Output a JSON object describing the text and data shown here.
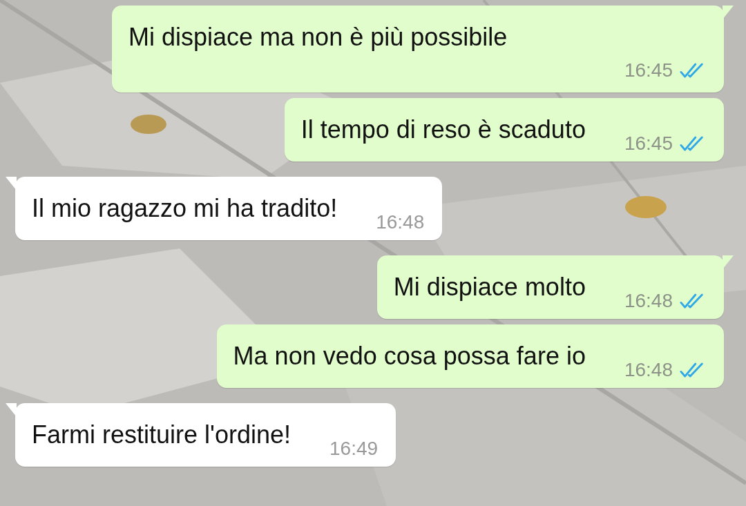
{
  "messages": [
    {
      "kind": "outgoing",
      "text": "Mi dispiace ma non è più possibile",
      "time": "16:45",
      "read": true,
      "tail": true,
      "wrapped": true
    },
    {
      "kind": "outgoing",
      "text": "Il tempo di reso è scaduto",
      "time": "16:45",
      "read": true,
      "tail": false,
      "wrapped": false
    },
    {
      "kind": "incoming",
      "text": "Il mio ragazzo mi ha tradito!",
      "time": "16:48",
      "tail": true,
      "wrapped": false
    },
    {
      "kind": "outgoing",
      "text": "Mi dispiace molto",
      "time": "16:48",
      "read": true,
      "tail": true,
      "wrapped": false
    },
    {
      "kind": "outgoing",
      "text": "Ma non vedo cosa possa fare io",
      "time": "16:48",
      "read": true,
      "tail": false,
      "wrapped": false
    },
    {
      "kind": "incoming",
      "text": "Farmi restituire l'ordine!",
      "time": "16:49",
      "tail": true,
      "wrapped": false
    }
  ]
}
